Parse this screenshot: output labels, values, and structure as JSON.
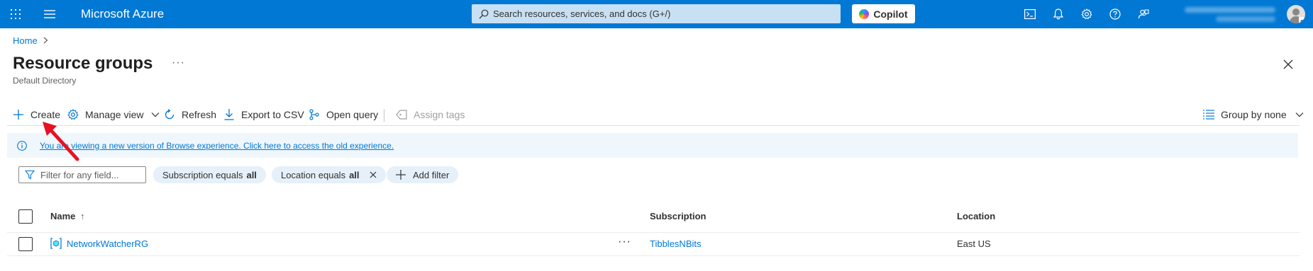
{
  "topbar": {
    "brand": "Microsoft Azure",
    "search_placeholder": "Search resources, services, and docs (G+/)",
    "copilot_label": "Copilot",
    "icons": [
      "cloud-shell-icon",
      "bell-icon",
      "gear-icon",
      "help-icon",
      "feedback-icon"
    ]
  },
  "breadcrumb": {
    "home": "Home"
  },
  "page": {
    "title": "Resource groups",
    "subtitle": "Default Directory"
  },
  "commands": {
    "create": "Create",
    "manage_view": "Manage view",
    "refresh": "Refresh",
    "export_csv": "Export to CSV",
    "open_query": "Open query",
    "assign_tags": "Assign tags",
    "group_by": "Group by none"
  },
  "banner": {
    "text": "You are viewing a new version of Browse experience. Click here to access the old experience."
  },
  "filters": {
    "field_placeholder": "Filter for any field...",
    "subscription_label": "Subscription equals",
    "subscription_value": "all",
    "location_label": "Location equals",
    "location_value": "all",
    "add_filter": "Add filter"
  },
  "table": {
    "headers": {
      "name": "Name",
      "name_sort": "↑",
      "subscription": "Subscription",
      "location": "Location"
    },
    "rows": [
      {
        "name": "NetworkWatcherRG",
        "subscription": "TibblesNBits",
        "location": "East US"
      }
    ]
  },
  "colors": {
    "topbar": "#0078d4",
    "link": "#0078d4",
    "banner": "#eff6fc",
    "annotation_arrow": "#e81123"
  }
}
